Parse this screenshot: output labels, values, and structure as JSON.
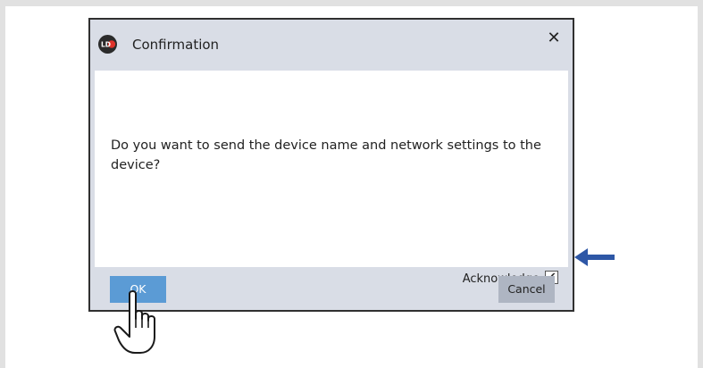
{
  "dialog": {
    "title": "Confirmation",
    "close_glyph": "✕",
    "message": "Do you want to send the device name and network settings to the device?",
    "acknowledge_label": "Acknowledge",
    "acknowledge_checked": true,
    "check_glyph": "✔",
    "ok_label": "OK",
    "cancel_label": "Cancel"
  },
  "icons": {
    "logo": "ld-logo-icon",
    "arrow": "arrow-left-icon",
    "cursor": "hand-pointer-icon"
  },
  "colors": {
    "accent_blue": "#5b9bd5",
    "arrow_blue": "#2e57a6",
    "dialog_chrome": "#d9dde6",
    "logo_red": "#e0332b"
  }
}
